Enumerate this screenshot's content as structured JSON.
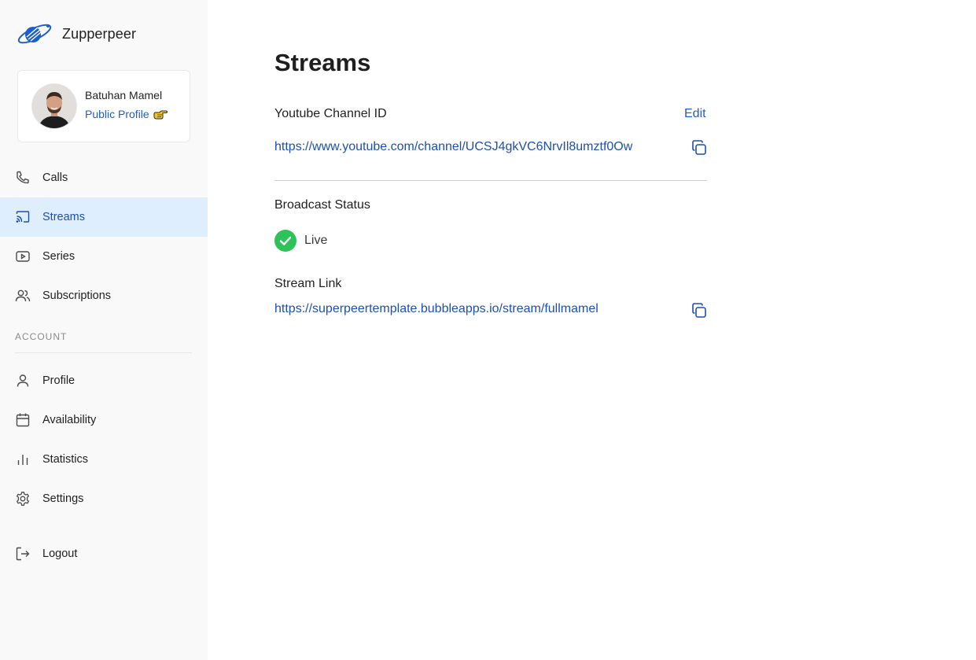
{
  "brand": {
    "name": "Zupperpeer",
    "logo_icon": "planet-logo-icon",
    "accent": "#1d5fc9"
  },
  "profile": {
    "name": "Batuhan Mamel",
    "link_label": "Public Profile",
    "link_icon": "pointing-hand-icon"
  },
  "nav": {
    "primary": [
      {
        "label": "Calls",
        "icon": "phone-icon",
        "active": false
      },
      {
        "label": "Streams",
        "icon": "cast-icon",
        "active": true
      },
      {
        "label": "Series",
        "icon": "play-icon",
        "active": false
      },
      {
        "label": "Subscriptions",
        "icon": "users-icon",
        "active": false
      }
    ],
    "section_label": "ACCOUNT",
    "account": [
      {
        "label": "Profile",
        "icon": "user-icon"
      },
      {
        "label": "Availability",
        "icon": "calendar-icon"
      },
      {
        "label": "Statistics",
        "icon": "bar-chart-icon"
      },
      {
        "label": "Settings",
        "icon": "gear-icon"
      }
    ],
    "logout": {
      "label": "Logout",
      "icon": "logout-icon"
    }
  },
  "main": {
    "title": "Streams",
    "youtube": {
      "label": "Youtube Channel ID",
      "edit_label": "Edit",
      "url": "https://www.youtube.com/channel/UCSJ4gkVC6NrvIl8umztf0Ow",
      "copy_icon": "copy-icon"
    },
    "broadcast": {
      "label": "Broadcast Status",
      "status": "Live",
      "status_color": "#2fc25b"
    },
    "stream_link": {
      "label": "Stream Link",
      "url": "https://superpeertemplate.bubbleapps.io/stream/fullmamel",
      "copy_icon": "copy-icon"
    }
  },
  "colors": {
    "active_bg": "#dfeefc",
    "link": "#1d4fb0",
    "sidebar_bg": "#f9f9f9"
  }
}
